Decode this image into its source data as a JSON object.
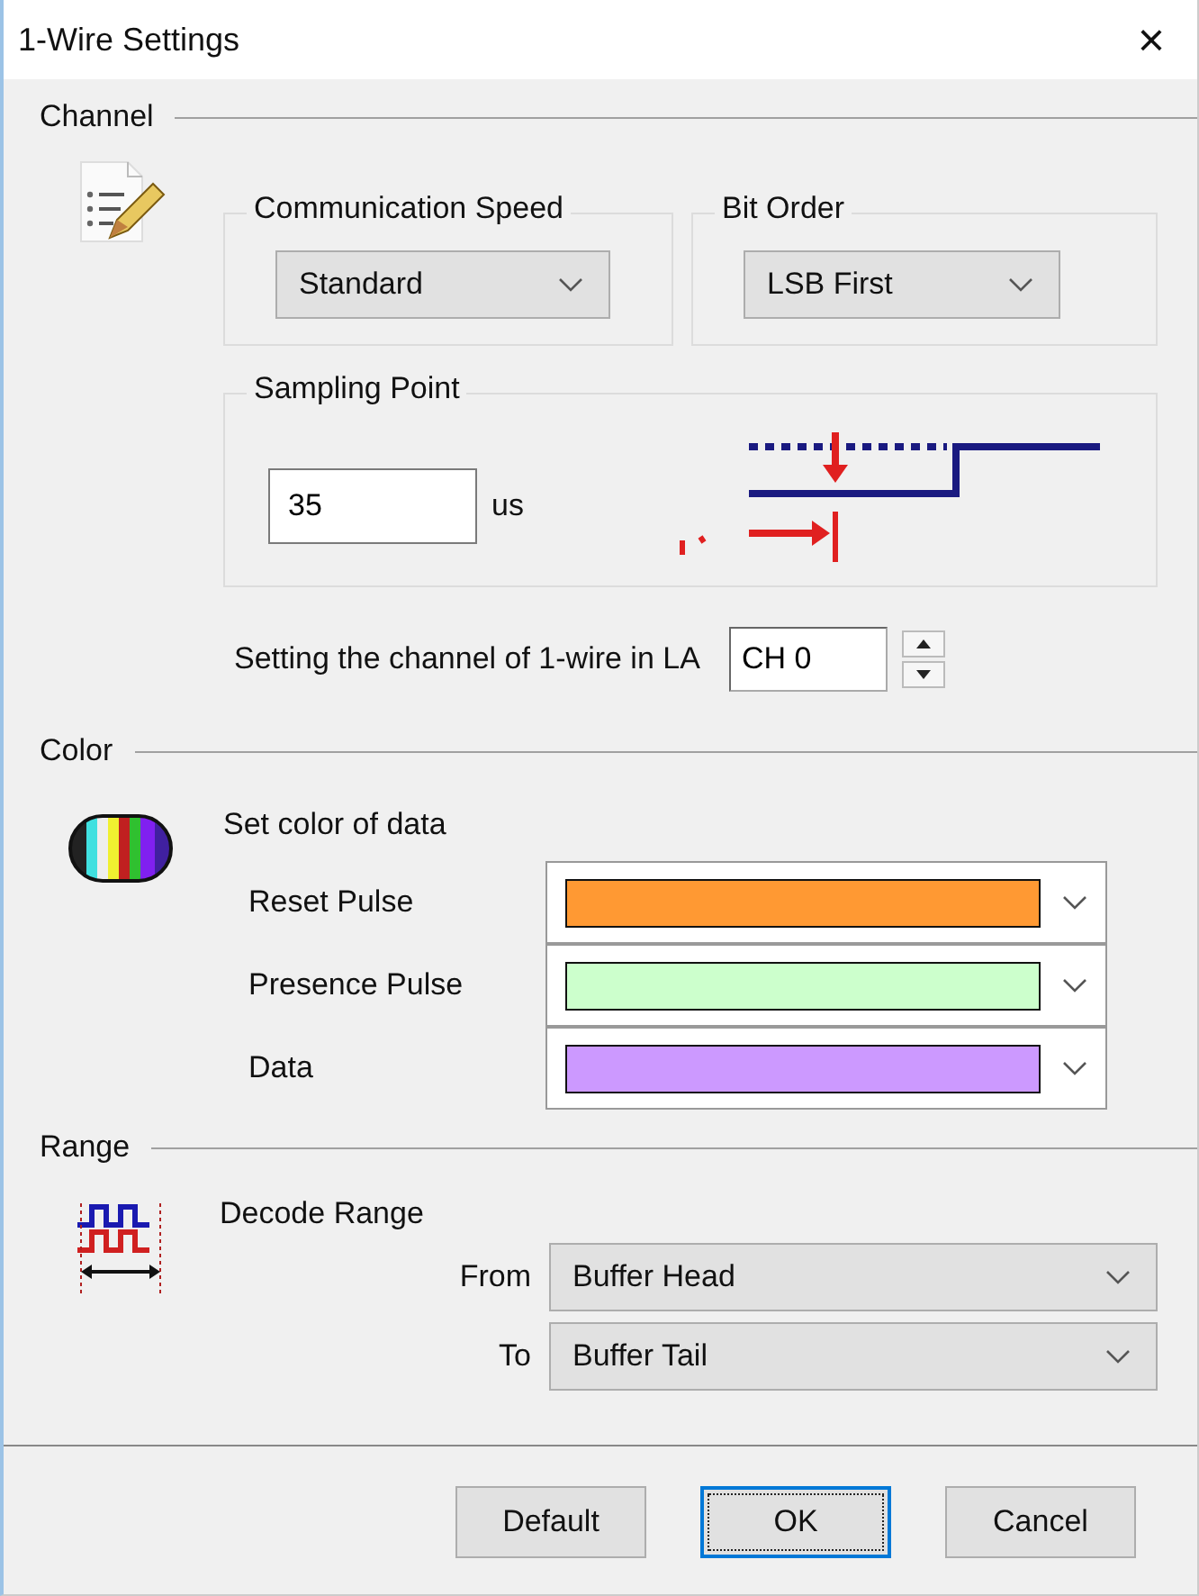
{
  "window": {
    "title": "1-Wire Settings",
    "close": "×"
  },
  "channel": {
    "heading": "Channel",
    "communication_speed": {
      "label": "Communication Speed",
      "value": "Standard"
    },
    "bit_order": {
      "label": "Bit Order",
      "value": "LSB First"
    },
    "sampling_point": {
      "label": "Sampling Point",
      "value": "35",
      "unit": "us"
    },
    "channel_setting": {
      "label": "Setting the channel of 1-wire in LA",
      "value": "CH 0"
    }
  },
  "color": {
    "heading": "Color",
    "title": "Set color of data",
    "items": [
      {
        "label": "Reset Pulse",
        "color": "#ff9933"
      },
      {
        "label": "Presence Pulse",
        "color": "#ccffcc"
      },
      {
        "label": "Data",
        "color": "#cc99ff"
      }
    ]
  },
  "range": {
    "heading": "Range",
    "title": "Decode Range",
    "from": {
      "label": "From",
      "value": "Buffer Head"
    },
    "to": {
      "label": "To",
      "value": "Buffer Tail"
    }
  },
  "buttons": [
    {
      "label": "Default",
      "focused": false
    },
    {
      "label": "OK",
      "focused": true
    },
    {
      "label": "Cancel",
      "focused": false
    }
  ]
}
